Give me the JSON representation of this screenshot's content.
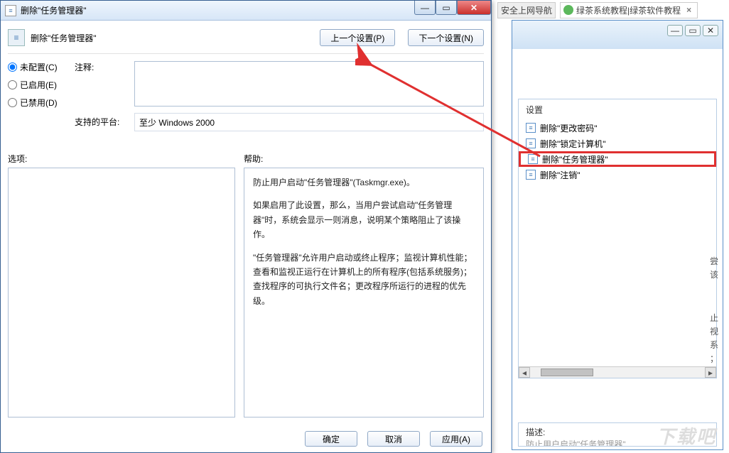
{
  "browser": {
    "tab1": {
      "label": "安全上网导航",
      "close": "×"
    },
    "tab2": {
      "label": "绿茶系统教程|绿茶软件教程",
      "close": "×"
    }
  },
  "bg_window": {
    "ctrl_min": "—",
    "ctrl_max": "▭",
    "ctrl_close": "✕",
    "settings_header": "设置",
    "items": [
      {
        "label": "删除\"更改密码\""
      },
      {
        "label": "删除\"锁定计算机\""
      },
      {
        "label": "删除\"任务管理器\""
      },
      {
        "label": "删除\"注销\""
      }
    ],
    "frag": [
      "尝",
      "该",
      "",
      "",
      "止",
      "视",
      "系",
      "；"
    ],
    "desc_label": "描述:",
    "desc_text": "防止用户启动\"任务管理器\""
  },
  "dialog": {
    "title": "删除\"任务管理器\"",
    "ctrl_min": "—",
    "ctrl_max": "▭",
    "ctrl_close": "✕",
    "header_title": "删除\"任务管理器\"",
    "prev_btn": "上一个设置(P)",
    "next_btn": "下一个设置(N)",
    "radio": {
      "not_configured": "未配置(C)",
      "enabled": "已启用(E)",
      "disabled": "已禁用(D)"
    },
    "labels": {
      "comment": "注释:",
      "platform": "支持的平台:",
      "options": "选项:",
      "help": "帮助:"
    },
    "comment_value": "",
    "platform_value": "至少 Windows 2000",
    "help_text": {
      "p1": "防止用户启动\"任务管理器\"(Taskmgr.exe)。",
      "p2": "如果启用了此设置，那么，当用户尝试启动\"任务管理器\"时，系统会显示一则消息，说明某个策略阻止了该操作。",
      "p3": "\"任务管理器\"允许用户启动或终止程序；监视计算机性能；查看和监视正运行在计算机上的所有程序(包括系统服务)；查找程序的可执行文件名；更改程序所运行的进程的优先级。"
    },
    "ok_btn": "确定",
    "cancel_btn": "取消",
    "apply_btn": "应用(A)"
  },
  "watermark": "下载吧"
}
